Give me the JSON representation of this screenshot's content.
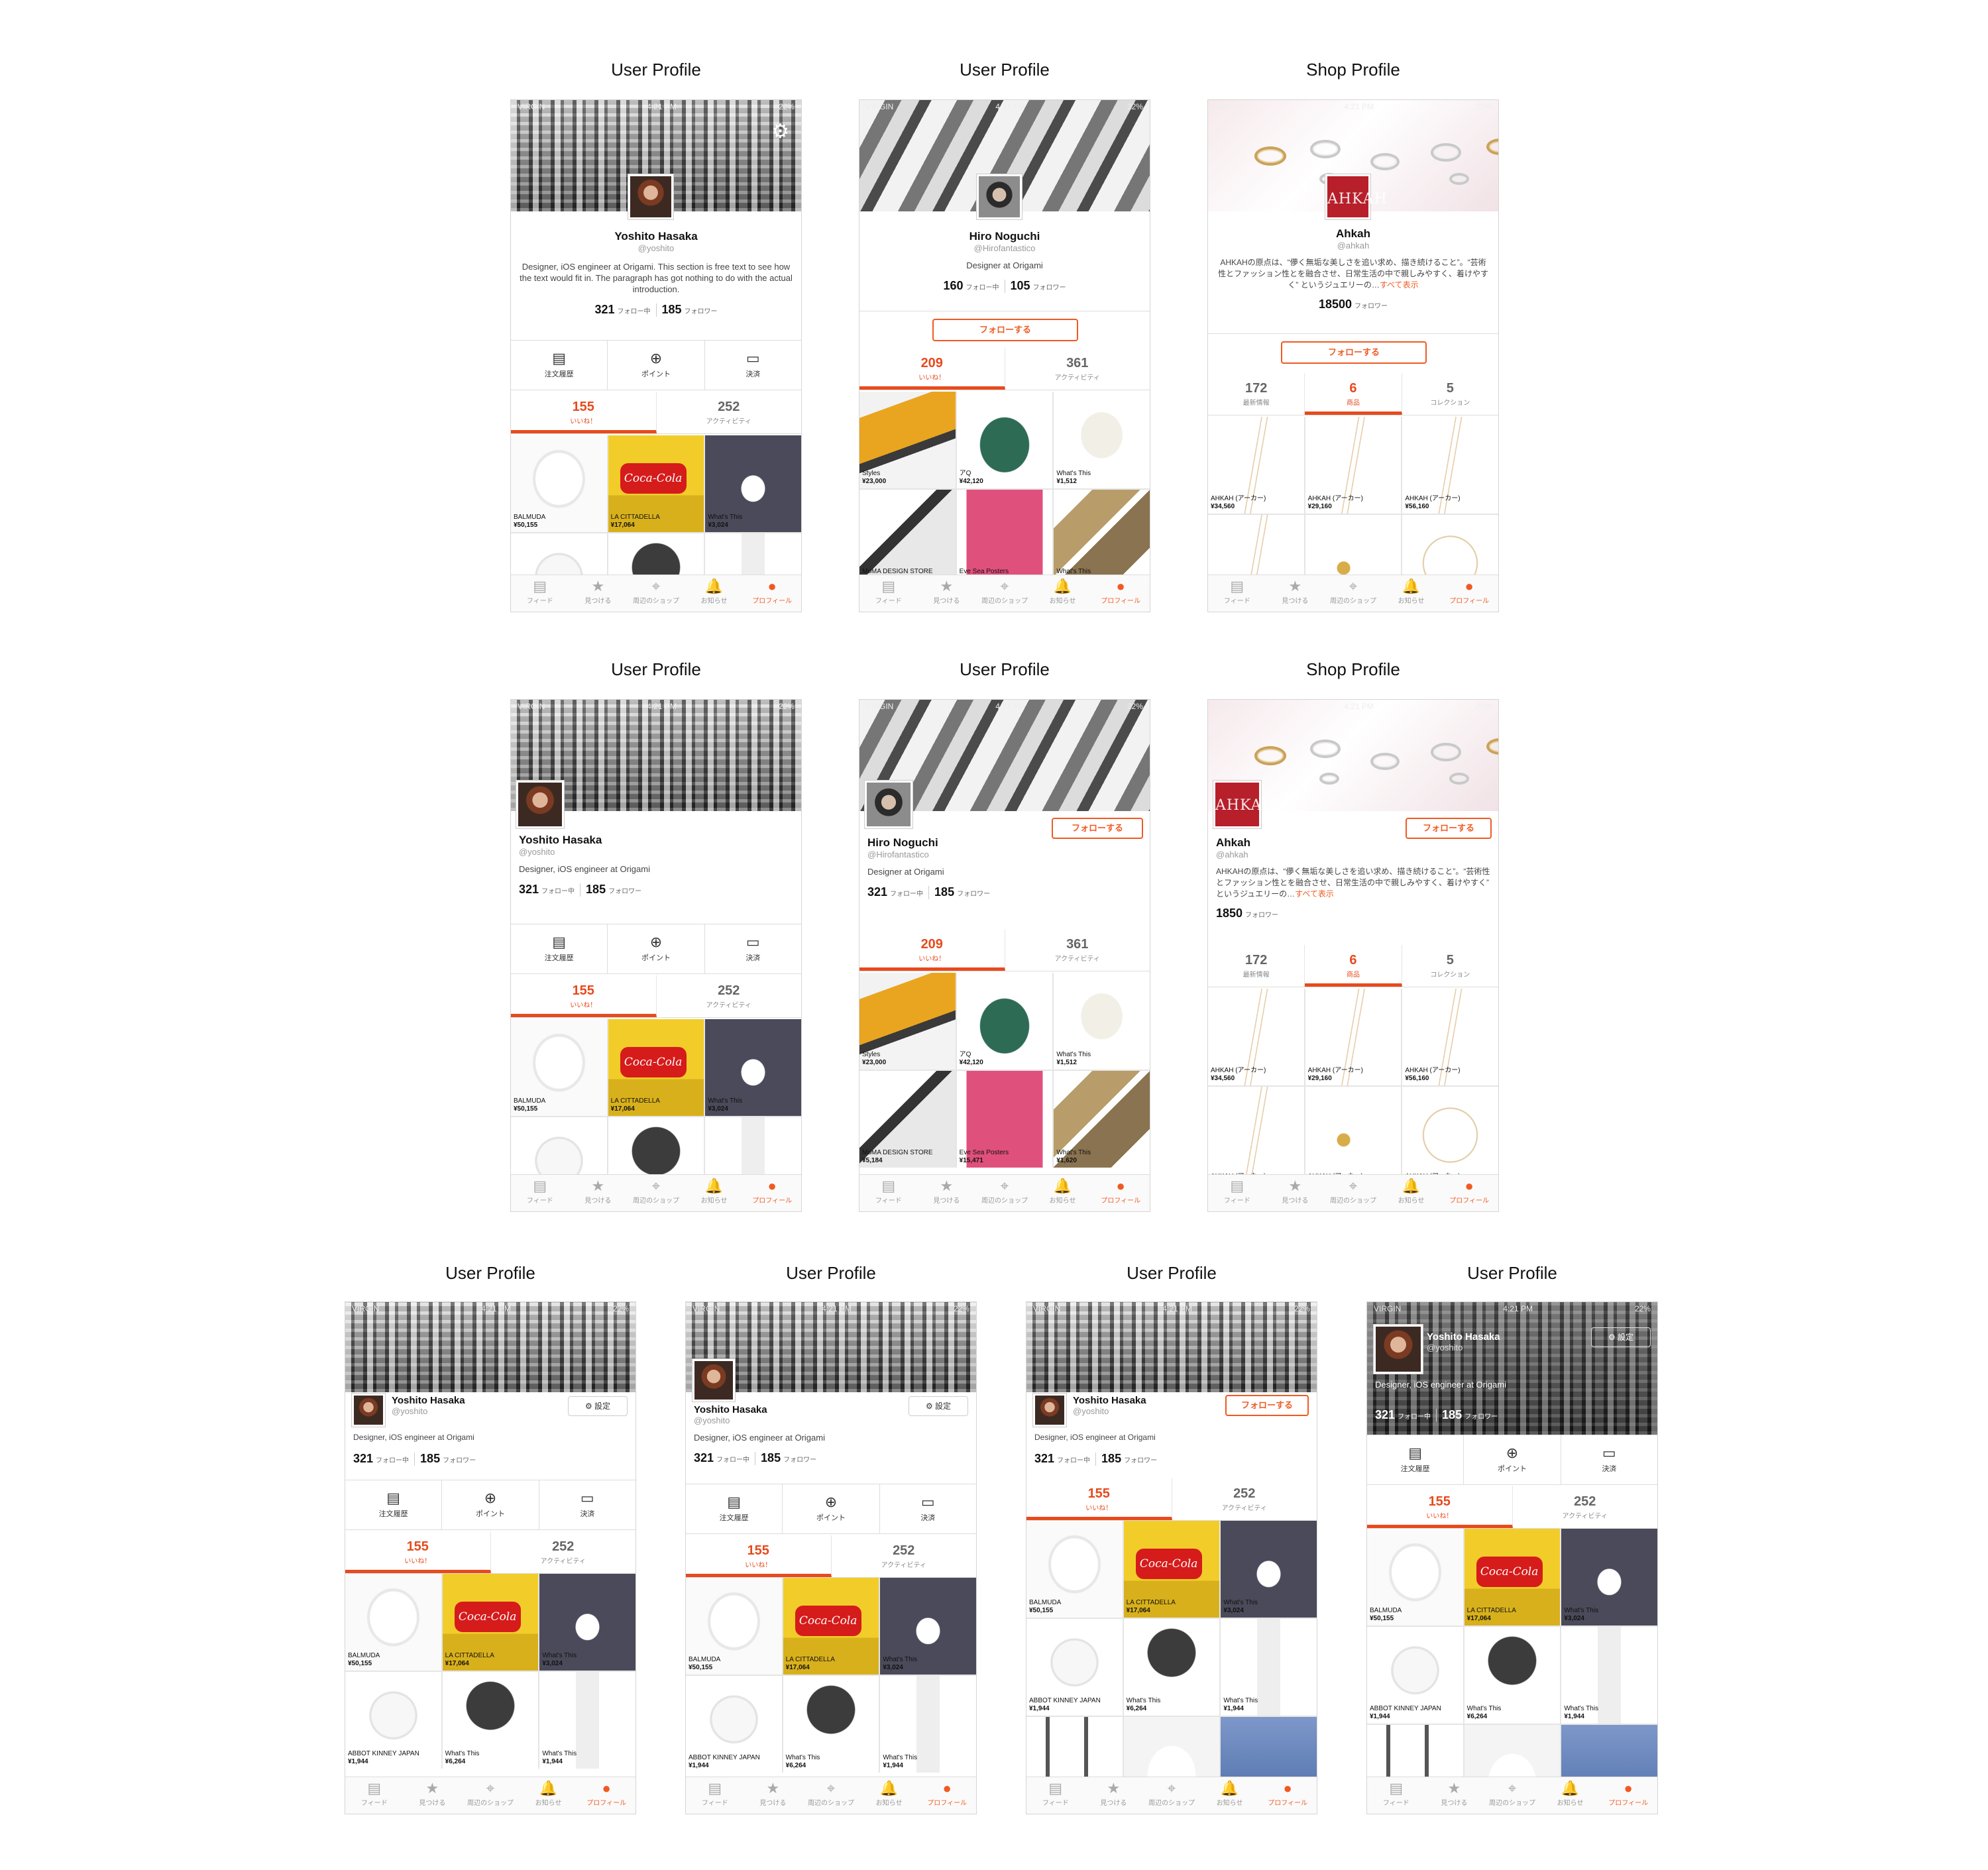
{
  "status": {
    "carrier": "VIRGIN",
    "time": "4:21 PM",
    "battery": "22%"
  },
  "titles": {
    "user": "User Profile",
    "shop": "Shop Profile"
  },
  "yoshito": {
    "name": "Yoshito Hasaka",
    "handle": "@yoshito",
    "bio_long": "Designer, iOS engineer at Origami. This section is free text to see how the text would fit in. The paragraph has got nothing to do with the actual introduction.",
    "bio_short": "Designer, iOS engineer at Origami",
    "following": "321",
    "following_label": "フォロー中",
    "followers": "185",
    "followers_label": "フォロワー"
  },
  "hiro": {
    "name": "Hiro Noguchi",
    "handle": "@Hirofantastico",
    "bio": "Designer at Origami",
    "following": "160",
    "followers": "105",
    "following2": "321",
    "followers2": "185"
  },
  "shop": {
    "name": "Ahkah",
    "handle": "@ahkah",
    "logo": "AHKAH",
    "bio": "AHKAHの原点は、“儚く無垢な美しさを追い求め、描き続けること”。“芸術性とファッション性とを融合させ、日常生活の中で親しみやすく、着けやすく” というジュエリーの…",
    "more": "すべて表示",
    "followers1": "18500",
    "followers2": "1850",
    "followers_label": "フォロワー"
  },
  "follow_label": "フォローする",
  "settings_label": "設定",
  "actions": [
    "注文履歴",
    "ポイント",
    "決済"
  ],
  "user_tabs": [
    {
      "count": "155",
      "label": "いいね！"
    },
    {
      "count": "252",
      "label": "アクティビティ"
    }
  ],
  "hiro_tabs": [
    {
      "count": "209",
      "label": "いいね！"
    },
    {
      "count": "361",
      "label": "アクティビティ"
    }
  ],
  "shop_tabs": [
    {
      "count": "172",
      "label": "最新情報"
    },
    {
      "count": "6",
      "label": "商品"
    },
    {
      "count": "5",
      "label": "コレクション"
    }
  ],
  "items_user": [
    {
      "name": "BALMUDA",
      "price": "¥50,155"
    },
    {
      "name": "LA CITTADELLA",
      "price": "¥17,064"
    },
    {
      "name": "What's This",
      "price": "¥3,024"
    },
    {
      "name": "ABBOT KINNEY JAPAN",
      "price": "¥1,944"
    },
    {
      "name": "What's This",
      "price": "¥6,264"
    },
    {
      "name": "What's This",
      "price": "¥1,944"
    }
  ],
  "items_hiro": [
    {
      "name": "Styles",
      "price": "¥23,000"
    },
    {
      "name": "アQ",
      "price": "¥42,120"
    },
    {
      "name": "What's This",
      "price": "¥1,512"
    },
    {
      "name": "MoMA DESIGN STORE",
      "price": "¥5,184"
    },
    {
      "name": "Eve Sea Posters",
      "price": "¥15,471"
    },
    {
      "name": "What's This",
      "price": "¥1,620"
    }
  ],
  "items_shop": [
    {
      "name": "AHKAH (アーカー)",
      "price": "¥34,560"
    },
    {
      "name": "AHKAH (アーカー)",
      "price": "¥29,160"
    },
    {
      "name": "AHKAH (アーカー)",
      "price": "¥56,160"
    },
    {
      "name": "AHKAH (アーカー)",
      "price": ""
    },
    {
      "name": "AHKAH (アーカー)",
      "price": ""
    },
    {
      "name": "AHKAH (アーカー)",
      "price": ""
    }
  ],
  "tabbar": [
    {
      "label": "フィード",
      "icon": "feed-icon"
    },
    {
      "label": "見つける",
      "icon": "star-icon"
    },
    {
      "label": "周辺のショップ",
      "icon": "pin-icon"
    },
    {
      "label": "お知らせ",
      "icon": "bell-icon"
    },
    {
      "label": "プロフィール",
      "icon": "profile-icon"
    }
  ]
}
